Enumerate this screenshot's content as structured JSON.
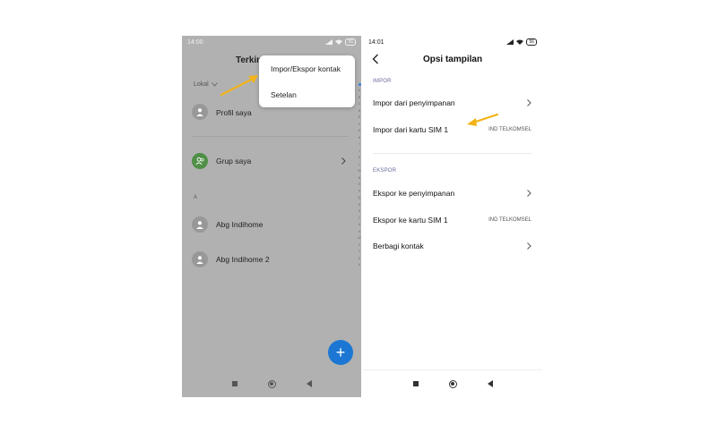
{
  "left_screen": {
    "status": {
      "time": "14:00",
      "battery": "56"
    },
    "title": "Terkini",
    "filter": "Lokal",
    "rows": [
      {
        "label": "Profil saya"
      },
      {
        "label": "Grup saya"
      }
    ],
    "section_a": "A",
    "contacts": [
      {
        "label": "Abg Indihome"
      },
      {
        "label": "Abg Indihome 2"
      }
    ],
    "index_letters": [
      "A",
      "B",
      "C",
      "D",
      "E",
      "F",
      "G",
      "H",
      "I",
      "J",
      "K",
      "L",
      "M",
      "N",
      "O",
      "P",
      "Q",
      "R",
      "S",
      "T",
      "U",
      "V",
      "W",
      "X",
      "Y",
      "Z",
      "#"
    ],
    "fab_symbol": "+",
    "menu": [
      {
        "label": "Impor/Ekspor kontak"
      },
      {
        "label": "Setelan"
      }
    ]
  },
  "right_screen": {
    "status": {
      "time": "14:01",
      "battery": "56"
    },
    "title": "Opsi tampilan",
    "impor_header": "IMPOR",
    "impor_rows": [
      {
        "label": "Impor dari penyimpanan",
        "value": ""
      },
      {
        "label": "Impor dari kartu SIM 1",
        "value": "IND TELKOMSEL"
      }
    ],
    "ekspor_header": "EKSPOR",
    "ekspor_rows": [
      {
        "label": "Ekspor ke penyimpanan",
        "value": ""
      },
      {
        "label": "Ekspor ke kartu SIM 1",
        "value": "IND TELKOMSEL"
      },
      {
        "label": "Berbagi kontak",
        "value": ""
      }
    ]
  },
  "colors": {
    "annotation_arrow": "#f2b418",
    "fab": "#1b77d3",
    "group_avatar": "#4f8f46",
    "dim_overlay": "#b1b1b1"
  }
}
